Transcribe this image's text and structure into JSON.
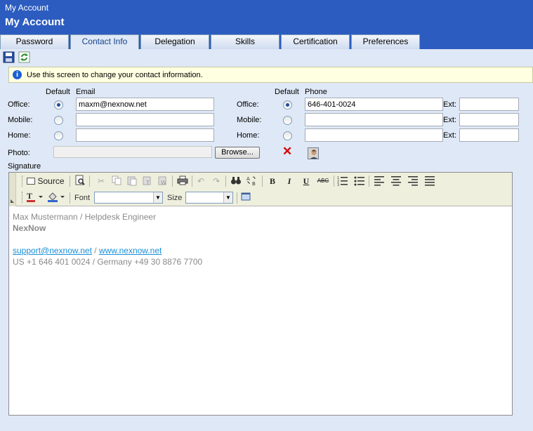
{
  "window": {
    "title": "My Account"
  },
  "page": {
    "title": "My Account"
  },
  "tabs": [
    {
      "label": "Password"
    },
    {
      "label": "Contact Info",
      "active": true
    },
    {
      "label": "Delegation"
    },
    {
      "label": "Skills"
    },
    {
      "label": "Certification"
    },
    {
      "label": "Preferences"
    }
  ],
  "toolbar": {
    "save_icon": "save-icon",
    "refresh_icon": "refresh-icon"
  },
  "info": {
    "icon": "info-icon",
    "text": "Use this screen to change your contact information."
  },
  "email": {
    "default_header": "Default",
    "header": "Email",
    "rows": [
      {
        "label": "Office:",
        "value": "maxm@nexnow.net",
        "default": true
      },
      {
        "label": "Mobile:",
        "value": "",
        "default": false
      },
      {
        "label": "Home:",
        "value": "",
        "default": false
      }
    ]
  },
  "phone": {
    "default_header": "Default",
    "header": "Phone",
    "ext_label": "Ext:",
    "rows": [
      {
        "label": "Office:",
        "value": "646-401-0024",
        "default": true,
        "ext": ""
      },
      {
        "label": "Mobile:",
        "value": "",
        "default": false,
        "ext": ""
      },
      {
        "label": "Home:",
        "value": "",
        "default": false,
        "ext": ""
      }
    ]
  },
  "photo": {
    "label": "Photo:",
    "value": "",
    "browse_label": "Browse...",
    "delete_icon": "delete-icon"
  },
  "signature": {
    "label": "Signature",
    "editor": {
      "source_label": "Source",
      "font_label": "Font",
      "size_label": "Size",
      "font_value": "",
      "size_value": ""
    },
    "content": {
      "line1": "Max Mustermann / Helpdesk Engineer",
      "line2": "NexNow",
      "email_link": "support@nexnow.net",
      "separator": " / ",
      "web_link": "www.nexnow.net",
      "line4": "US +1 646 401 0024 / Germany +49 30 8876 7700"
    }
  },
  "colors": {
    "header_blue": "#2c5cc0",
    "panel_bg": "#dfe8f6",
    "info_bg": "#ffffe1",
    "link": "#1a8fd8"
  }
}
